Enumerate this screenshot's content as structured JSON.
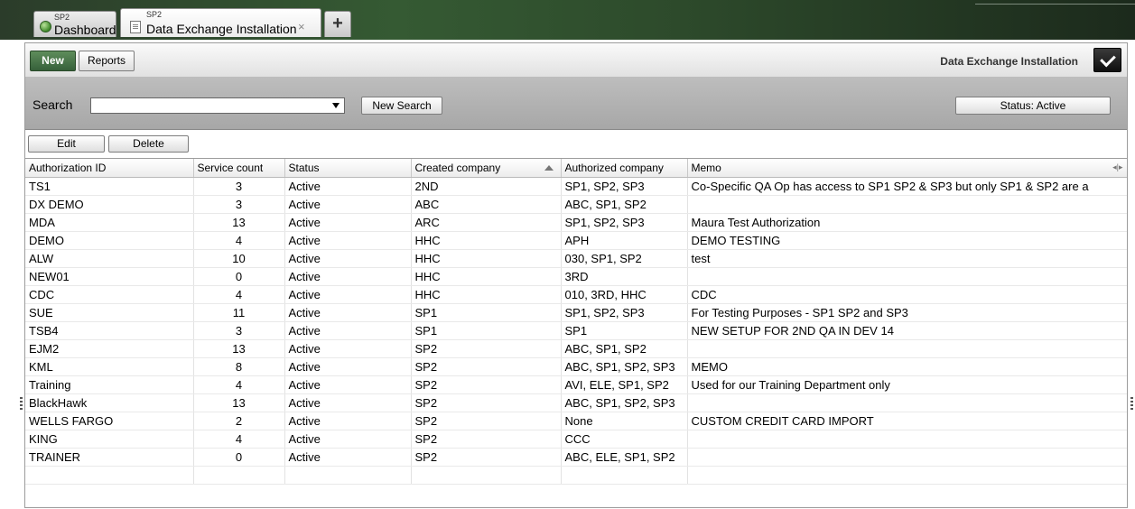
{
  "tabs": [
    {
      "sub": "SP2",
      "label": "Dashboard",
      "icon": "status-dot-icon"
    },
    {
      "sub": "SP2",
      "label": "Data Exchange Installation",
      "icon": "document-icon",
      "close": "×"
    }
  ],
  "add_tab_label": "+",
  "toolbar": {
    "new_label": "New",
    "reports_label": "Reports",
    "title": "Data Exchange Installation"
  },
  "search": {
    "label": "Search",
    "value": "",
    "placeholder": "",
    "new_search_label": "New Search",
    "status_label": "Status: Active"
  },
  "actions": {
    "edit_label": "Edit",
    "delete_label": "Delete"
  },
  "table": {
    "columns": [
      "Authorization ID",
      "Service count",
      "Status",
      "Created company",
      "Authorized company",
      "Memo"
    ],
    "sorted_column": "Created company",
    "rows": [
      [
        "TS1",
        "3",
        "Active",
        "2ND",
        "SP1, SP2, SP3",
        "Co-Specific QA Op has access to SP1 SP2 & SP3 but only SP1 & SP2 are a"
      ],
      [
        "DX DEMO",
        "3",
        "Active",
        "ABC",
        "ABC, SP1, SP2",
        ""
      ],
      [
        "MDA",
        "13",
        "Active",
        "ARC",
        "SP1, SP2, SP3",
        "Maura Test Authorization"
      ],
      [
        "DEMO",
        "4",
        "Active",
        "HHC",
        "APH",
        "DEMO TESTING"
      ],
      [
        "ALW",
        "10",
        "Active",
        "HHC",
        "030, SP1, SP2",
        "test"
      ],
      [
        "NEW01",
        "0",
        "Active",
        "HHC",
        "3RD",
        ""
      ],
      [
        "CDC",
        "4",
        "Active",
        "HHC",
        "010, 3RD, HHC",
        "CDC"
      ],
      [
        "SUE",
        "11",
        "Active",
        "SP1",
        "SP1, SP2, SP3",
        "For Testing Purposes - SP1 SP2 and SP3"
      ],
      [
        "TSB4",
        "3",
        "Active",
        "SP1",
        "SP1",
        "NEW SETUP FOR 2ND QA IN DEV 14"
      ],
      [
        "EJM2",
        "13",
        "Active",
        "SP2",
        "ABC, SP1, SP2",
        ""
      ],
      [
        "KML",
        "8",
        "Active",
        "SP2",
        "ABC, SP1, SP2, SP3",
        "MEMO"
      ],
      [
        "Training",
        "4",
        "Active",
        "SP2",
        "AVI, ELE, SP1, SP2",
        "Used for our Training Department only"
      ],
      [
        "BlackHawk",
        "13",
        "Active",
        "SP2",
        "ABC, SP1, SP2, SP3",
        ""
      ],
      [
        "WELLS FARGO",
        "2",
        "Active",
        "SP2",
        "None",
        "CUSTOM CREDIT CARD IMPORT"
      ],
      [
        "KING",
        "4",
        "Active",
        "SP2",
        "CCC",
        ""
      ],
      [
        "TRAINER",
        "0",
        "Active",
        "SP2",
        "ABC, ELE, SP1, SP2",
        ""
      ]
    ]
  },
  "colors": {
    "accent_green": "#36603a",
    "toolbar_bg": "#e1e1e1",
    "search_bg": "#b0b0b0"
  }
}
